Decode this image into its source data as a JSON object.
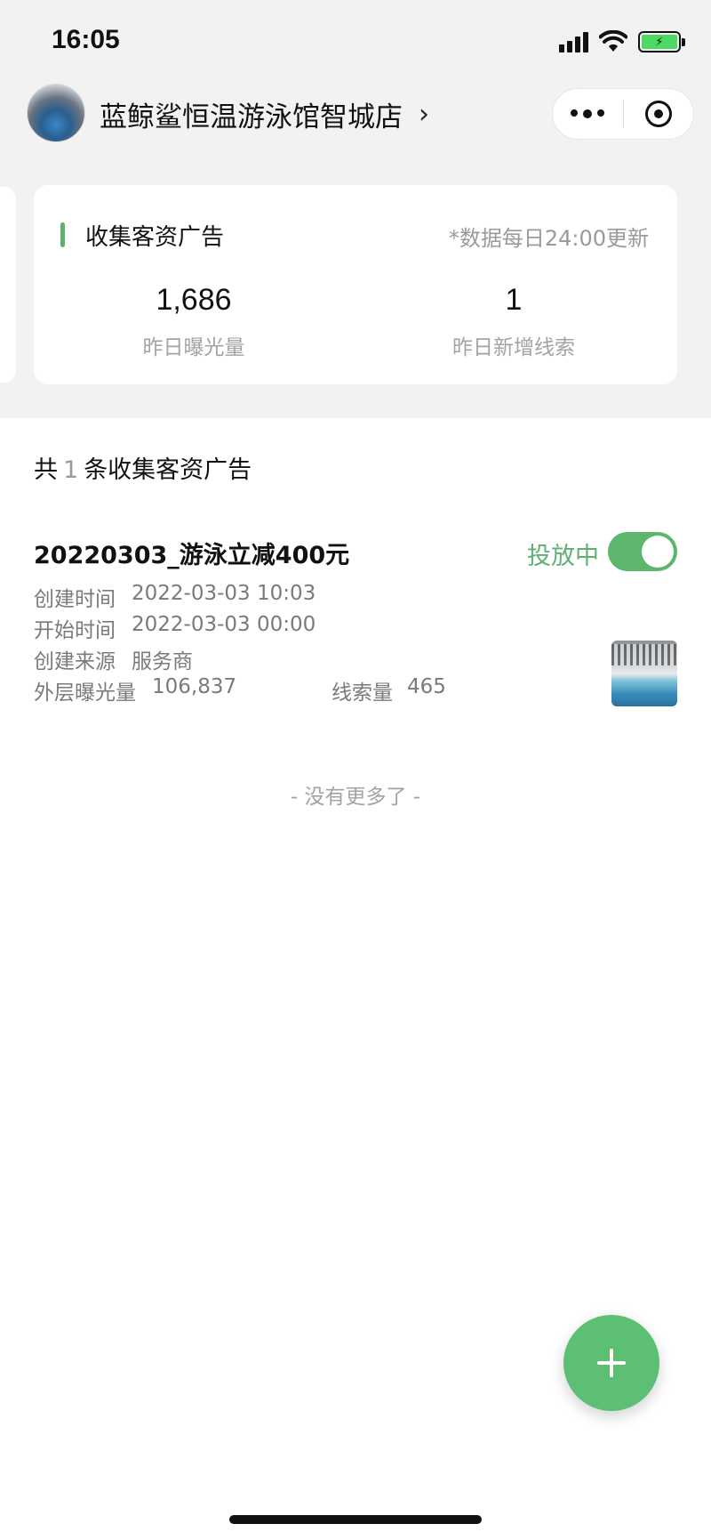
{
  "status_bar": {
    "time": "16:05",
    "icons": [
      "signal-icon",
      "wifi-icon",
      "battery-charging-icon"
    ]
  },
  "header": {
    "store_name": "蓝鲸鲨恒温游泳馆智城店",
    "chevron": "›",
    "capsule": [
      "more-icon",
      "close-target-icon"
    ]
  },
  "stats_card": {
    "title": "收集客资广告",
    "note": "*数据每日24:00更新",
    "stats": [
      {
        "value": "1,686",
        "label": "昨日曝光量"
      },
      {
        "value": "1",
        "label": "昨日新增线索"
      }
    ]
  },
  "list": {
    "prefix": "共",
    "count": "1",
    "suffix": "条收集客资广告",
    "items": [
      {
        "title": "20220303_游泳立减400元",
        "status": "投放中",
        "active": true,
        "created_label": "创建时间",
        "created_value": "2022-03-03 10:03",
        "start_label": "开始时间",
        "start_value": "2022-03-03 00:00",
        "source_label": "创建来源",
        "source_value": "服务商",
        "exposure_label": "外层曝光量",
        "exposure_value": "106,837",
        "leads_label": "线索量",
        "leads_value": "465"
      }
    ],
    "no_more": "- 没有更多了 -"
  },
  "fab": {
    "icon": "plus-icon"
  },
  "colors": {
    "accent": "#5cb66c",
    "background": "#f2f2f2"
  }
}
